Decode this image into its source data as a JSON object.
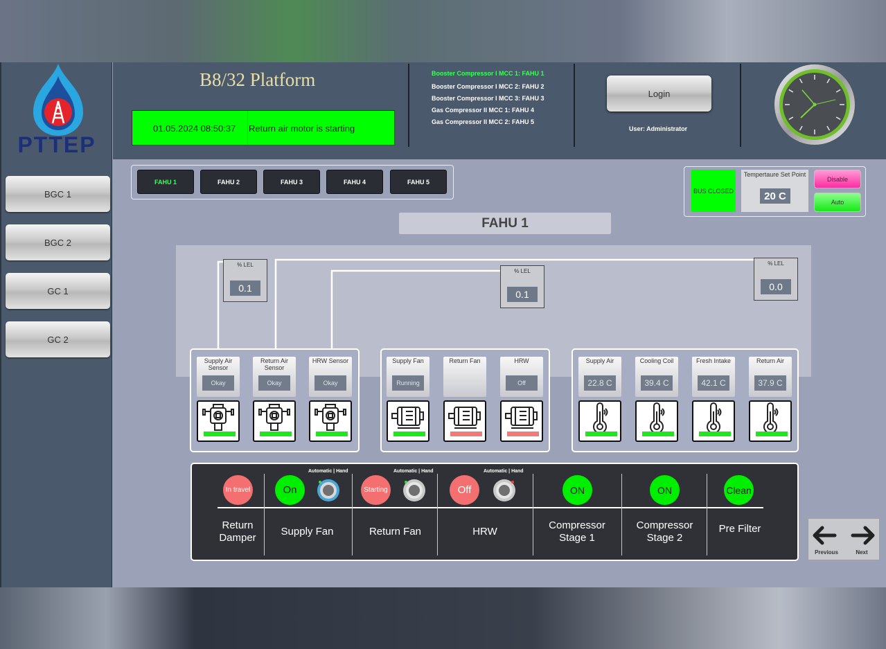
{
  "brand": {
    "logo_text": "PTTEP"
  },
  "sidebar": {
    "items": [
      {
        "label": "BGC 1"
      },
      {
        "label": "BGC 2"
      },
      {
        "label": "GC 1"
      },
      {
        "label": "GC 2"
      }
    ]
  },
  "header": {
    "platform_title": "B8/32 Platform",
    "alarm": {
      "datetime": "01.05.2024 08:50:37",
      "message": "Return air motor is starting"
    },
    "mcc_list": [
      {
        "label": "Booster Compressor I MCC 1: FAHU 1",
        "active": true
      },
      {
        "label": "Booster Compressor I MCC 2: FAHU 2",
        "active": false
      },
      {
        "label": "Booster Compressor I MCC 3: FAHU 3",
        "active": false
      },
      {
        "label": "Gas Compressor II MCC 1: FAHU 4",
        "active": false
      },
      {
        "label": "Gas Compressor II MCC 2: FAHU 5",
        "active": false
      }
    ],
    "login_label": "Login",
    "user_text": "User: Administrator"
  },
  "tabs": [
    {
      "label": "FAHU 1",
      "active": true
    },
    {
      "label": "FAHU 2"
    },
    {
      "label": "FAHU 3"
    },
    {
      "label": "FAHU 4"
    },
    {
      "label": "FAHU 5"
    }
  ],
  "status_panel": {
    "bus_label": "BUS CLOSED",
    "setpoint_title": "Tempertaure Set Point",
    "setpoint_value": "20 C",
    "disable_label": "Disable",
    "auto_label": "Auto"
  },
  "main": {
    "title": "FAHU 1",
    "lel": [
      {
        "label": "% LEL",
        "value": "0.1"
      },
      {
        "label": "% LEL",
        "value": "0.1"
      },
      {
        "label": "% LEL",
        "value": "0.0"
      }
    ],
    "sensors": [
      {
        "label": "Supply Air Sensor",
        "status": "Okay",
        "bar": "green"
      },
      {
        "label": "Return Air Sensor",
        "status": "Okay",
        "bar": "green"
      },
      {
        "label": "HRW Sensor",
        "status": "Okay",
        "bar": "green"
      }
    ],
    "motors": [
      {
        "label": "Supply Fan",
        "status": "Running",
        "bar": "green"
      },
      {
        "label": "Return Fan",
        "status": "",
        "bar": "red"
      },
      {
        "label": "HRW",
        "status": "Off",
        "bar": "red"
      }
    ],
    "temps": [
      {
        "label": "Supply Air",
        "value": "22.8 C",
        "bar": "green"
      },
      {
        "label": "Cooling Coil",
        "value": "39.4 C",
        "bar": "green"
      },
      {
        "label": "Fresh Intake",
        "value": "42.1 C",
        "bar": "green"
      },
      {
        "label": "Return Air",
        "value": "37.9 C",
        "bar": "green"
      }
    ]
  },
  "controls": {
    "mode_label": "Automatic | Hand",
    "items": [
      {
        "label_line1": "Return",
        "label_line2": "Damper",
        "state": "In travel"
      },
      {
        "label_line1": "Supply Fan",
        "label_line2": "",
        "state": "On"
      },
      {
        "label_line1": "Return Fan",
        "label_line2": "",
        "state": "Starting"
      },
      {
        "label_line1": "HRW",
        "label_line2": "",
        "state": "Off"
      },
      {
        "label_line1": "Compressor",
        "label_line2": "Stage 1",
        "state": "ON"
      },
      {
        "label_line1": "Compressor",
        "label_line2": "Stage 2",
        "state": "ON"
      },
      {
        "label_line1": "Pre Filter",
        "label_line2": "",
        "state": "Clean"
      }
    ]
  },
  "nav": {
    "previous_label": "Previous",
    "next_label": "Next"
  },
  "colors": {
    "alarm_green": "#00ff00",
    "bar_green": "#1fe61f",
    "bar_red": "#f07a7a",
    "header_bg": "#4a5a6c"
  }
}
